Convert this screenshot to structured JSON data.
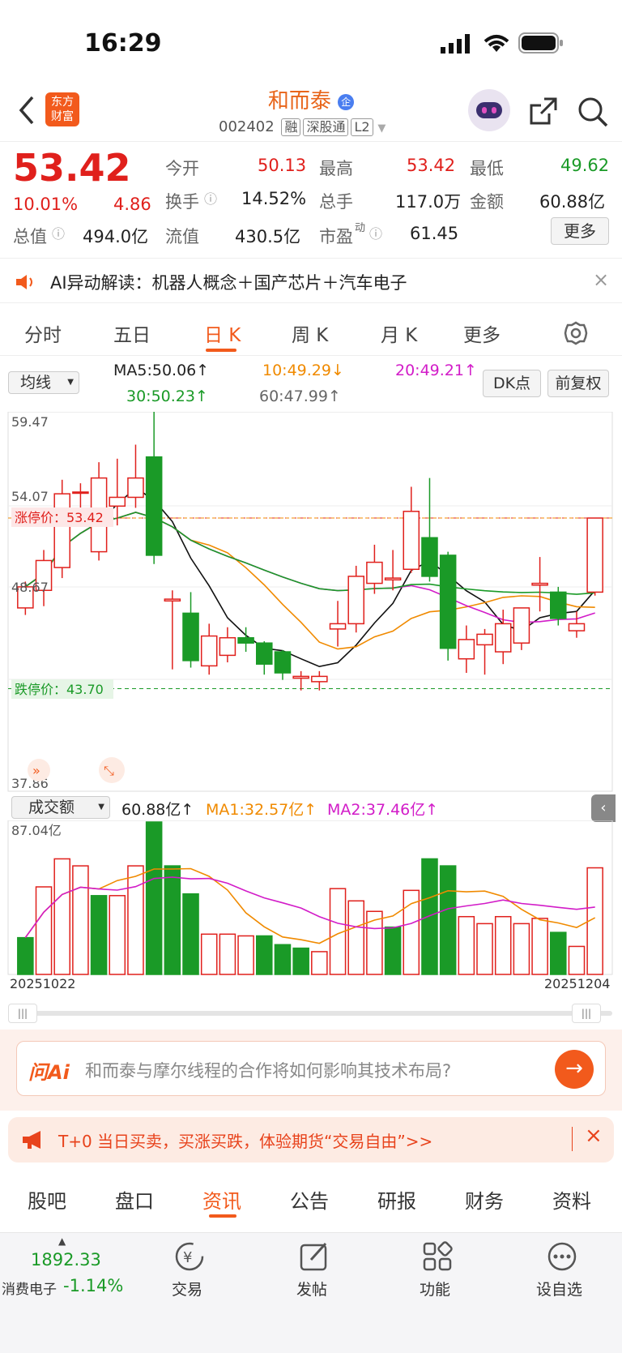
{
  "status": {
    "time": "16:29"
  },
  "header": {
    "title": "和而泰",
    "code": "002402",
    "tags": [
      "融",
      "深股通",
      "L2"
    ],
    "logo_line1": "东方",
    "logo_line2": "财富"
  },
  "quote": {
    "price": "53.42",
    "pct": "10.01%",
    "change": "4.86",
    "open_label": "今开",
    "open": "50.13",
    "high_label": "最高",
    "high": "53.42",
    "low_label": "最低",
    "low": "49.62",
    "turnover_label": "换手",
    "turnover": "14.52%",
    "volume_label": "总手",
    "volume": "117.0万",
    "amount_label": "金额",
    "amount": "60.88亿",
    "mktcap_label": "总值",
    "mktcap": "494.0亿",
    "float_label": "流值",
    "float": "430.5亿",
    "pe_label": "市盈",
    "pe_sup": "动",
    "pe": "61.45",
    "more": "更多"
  },
  "ai_bar": {
    "text": "AI异动解读：机器人概念＋国产芯片＋汽车电子"
  },
  "tabs": [
    "分时",
    "五日",
    "日 K",
    "周 K",
    "月 K",
    "更多"
  ],
  "chart_controls": {
    "ma_select": "均线",
    "dk": "DK点",
    "adjust": "前复权",
    "ma5": "MA5:50.06↑",
    "ma10": "10:49.29↓",
    "ma20": "20:49.21↑",
    "ma30": "30:50.23↑",
    "ma60": "60:47.99↑"
  },
  "vol_controls": {
    "select": "成交额",
    "amount": "60.88亿↑",
    "ma1": "MA1:32.57亿↑",
    "ma2": "MA2:37.46亿↑",
    "max_label": "87.04亿"
  },
  "chart_text": {
    "y_top": "59.47",
    "y_mid": "54.07",
    "y_low": "48.67",
    "y_bottom": "37.86",
    "limit_up": "涨停价：53.42",
    "limit_down": "跌停价：43.70",
    "date_start": "20251022",
    "date_end": "20251204"
  },
  "chart_data": {
    "type": "candlestick",
    "dates_range": [
      "20251022",
      "20251204"
    ],
    "ylim": [
      37.86,
      59.47
    ],
    "candles": [
      {
        "o": 48.3,
        "c": 49.5,
        "h": 49.8,
        "l": 47.9
      },
      {
        "o": 49.3,
        "c": 51.0,
        "h": 51.6,
        "l": 48.4
      },
      {
        "o": 50.6,
        "c": 54.8,
        "h": 55.6,
        "l": 50.0
      },
      {
        "o": 54.9,
        "c": 54.9,
        "h": 55.4,
        "l": 54.0
      },
      {
        "o": 51.5,
        "c": 55.7,
        "h": 56.6,
        "l": 51.0
      },
      {
        "o": 54.1,
        "c": 54.6,
        "h": 56.8,
        "l": 53.0
      },
      {
        "o": 54.6,
        "c": 55.7,
        "h": 57.6,
        "l": 54.0
      },
      {
        "o": 56.9,
        "c": 51.3,
        "h": 59.47,
        "l": 50.8
      },
      {
        "o": 48.7,
        "c": 48.8,
        "h": 49.3,
        "l": 44.8
      },
      {
        "o": 48.0,
        "c": 45.3,
        "h": 49.2,
        "l": 44.9
      },
      {
        "o": 45.0,
        "c": 46.7,
        "h": 47.4,
        "l": 44.5
      },
      {
        "o": 45.6,
        "c": 46.6,
        "h": 47.2,
        "l": 45.2
      },
      {
        "o": 46.6,
        "c": 46.3,
        "h": 47.2,
        "l": 45.8
      },
      {
        "o": 46.3,
        "c": 45.1,
        "h": 46.4,
        "l": 44.5
      },
      {
        "o": 45.8,
        "c": 44.6,
        "h": 45.9,
        "l": 44.2
      },
      {
        "o": 44.3,
        "c": 44.4,
        "h": 44.7,
        "l": 43.6
      },
      {
        "o": 44.1,
        "c": 44.4,
        "h": 44.7,
        "l": 43.6
      },
      {
        "o": 47.1,
        "c": 47.4,
        "h": 48.7,
        "l": 46.1
      },
      {
        "o": 47.4,
        "c": 50.1,
        "h": 50.7,
        "l": 46.9
      },
      {
        "o": 49.7,
        "c": 50.9,
        "h": 51.9,
        "l": 49.1
      },
      {
        "o": 49.9,
        "c": 50.0,
        "h": 51.6,
        "l": 49.3
      },
      {
        "o": 50.5,
        "c": 53.8,
        "h": 55.2,
        "l": 50.3
      },
      {
        "o": 52.3,
        "c": 50.1,
        "h": 55.7,
        "l": 49.8
      },
      {
        "o": 51.3,
        "c": 46.0,
        "h": 51.5,
        "l": 45.3
      },
      {
        "o": 45.4,
        "c": 46.5,
        "h": 47.3,
        "l": 44.6
      },
      {
        "o": 46.2,
        "c": 46.8,
        "h": 47.1,
        "l": 44.5
      },
      {
        "o": 45.8,
        "c": 47.4,
        "h": 48.2,
        "l": 45.1
      },
      {
        "o": 46.3,
        "c": 48.3,
        "h": 48.3,
        "l": 45.9
      },
      {
        "o": 49.6,
        "c": 49.7,
        "h": 51.2,
        "l": 48.1
      },
      {
        "o": 49.2,
        "c": 47.7,
        "h": 49.5,
        "l": 47.3
      },
      {
        "o": 47.0,
        "c": 47.4,
        "h": 48.1,
        "l": 46.6
      },
      {
        "o": 49.2,
        "c": 53.42,
        "h": 53.42,
        "l": 49.0
      }
    ],
    "limit_up": 53.42,
    "limit_down": 43.7,
    "volume": [
      {
        "v": 21,
        "up": false
      },
      {
        "v": 50,
        "up": true
      },
      {
        "v": 66,
        "up": true
      },
      {
        "v": 62,
        "up": true
      },
      {
        "v": 45,
        "up": false
      },
      {
        "v": 45,
        "up": true
      },
      {
        "v": 62,
        "up": true
      },
      {
        "v": 87.04,
        "up": false
      },
      {
        "v": 62,
        "up": false
      },
      {
        "v": 46,
        "up": false
      },
      {
        "v": 23,
        "up": true
      },
      {
        "v": 23,
        "up": true
      },
      {
        "v": 22,
        "up": true
      },
      {
        "v": 22,
        "up": false
      },
      {
        "v": 17,
        "up": false
      },
      {
        "v": 15,
        "up": false
      },
      {
        "v": 13,
        "up": true
      },
      {
        "v": 49,
        "up": true
      },
      {
        "v": 42,
        "up": true
      },
      {
        "v": 36,
        "up": true
      },
      {
        "v": 27,
        "up": false
      },
      {
        "v": 48,
        "up": true
      },
      {
        "v": 66,
        "up": false
      },
      {
        "v": 62,
        "up": false
      },
      {
        "v": 33,
        "up": true
      },
      {
        "v": 29,
        "up": true
      },
      {
        "v": 33,
        "up": true
      },
      {
        "v": 29,
        "up": true
      },
      {
        "v": 32,
        "up": true
      },
      {
        "v": 24,
        "up": false
      },
      {
        "v": 16,
        "up": true
      },
      {
        "v": 60.88,
        "up": true
      }
    ]
  },
  "ask_ai": {
    "brand": "问Ai",
    "placeholder": "和而泰与摩尔线程的合作将如何影响其技术布局?"
  },
  "promo": {
    "text": "T+0 当日买卖，买涨买跌，体验期货“交易自由”>>"
  },
  "bottom_tabs": [
    "股吧",
    "盘口",
    "资讯",
    "公告",
    "研报",
    "财务",
    "资料"
  ],
  "nav": {
    "index_value": "1892.33",
    "index_name": "消费电子",
    "index_pct": "-1.14%",
    "trade": "交易",
    "post": "发帖",
    "functions": "功能",
    "watch": "设自选"
  }
}
